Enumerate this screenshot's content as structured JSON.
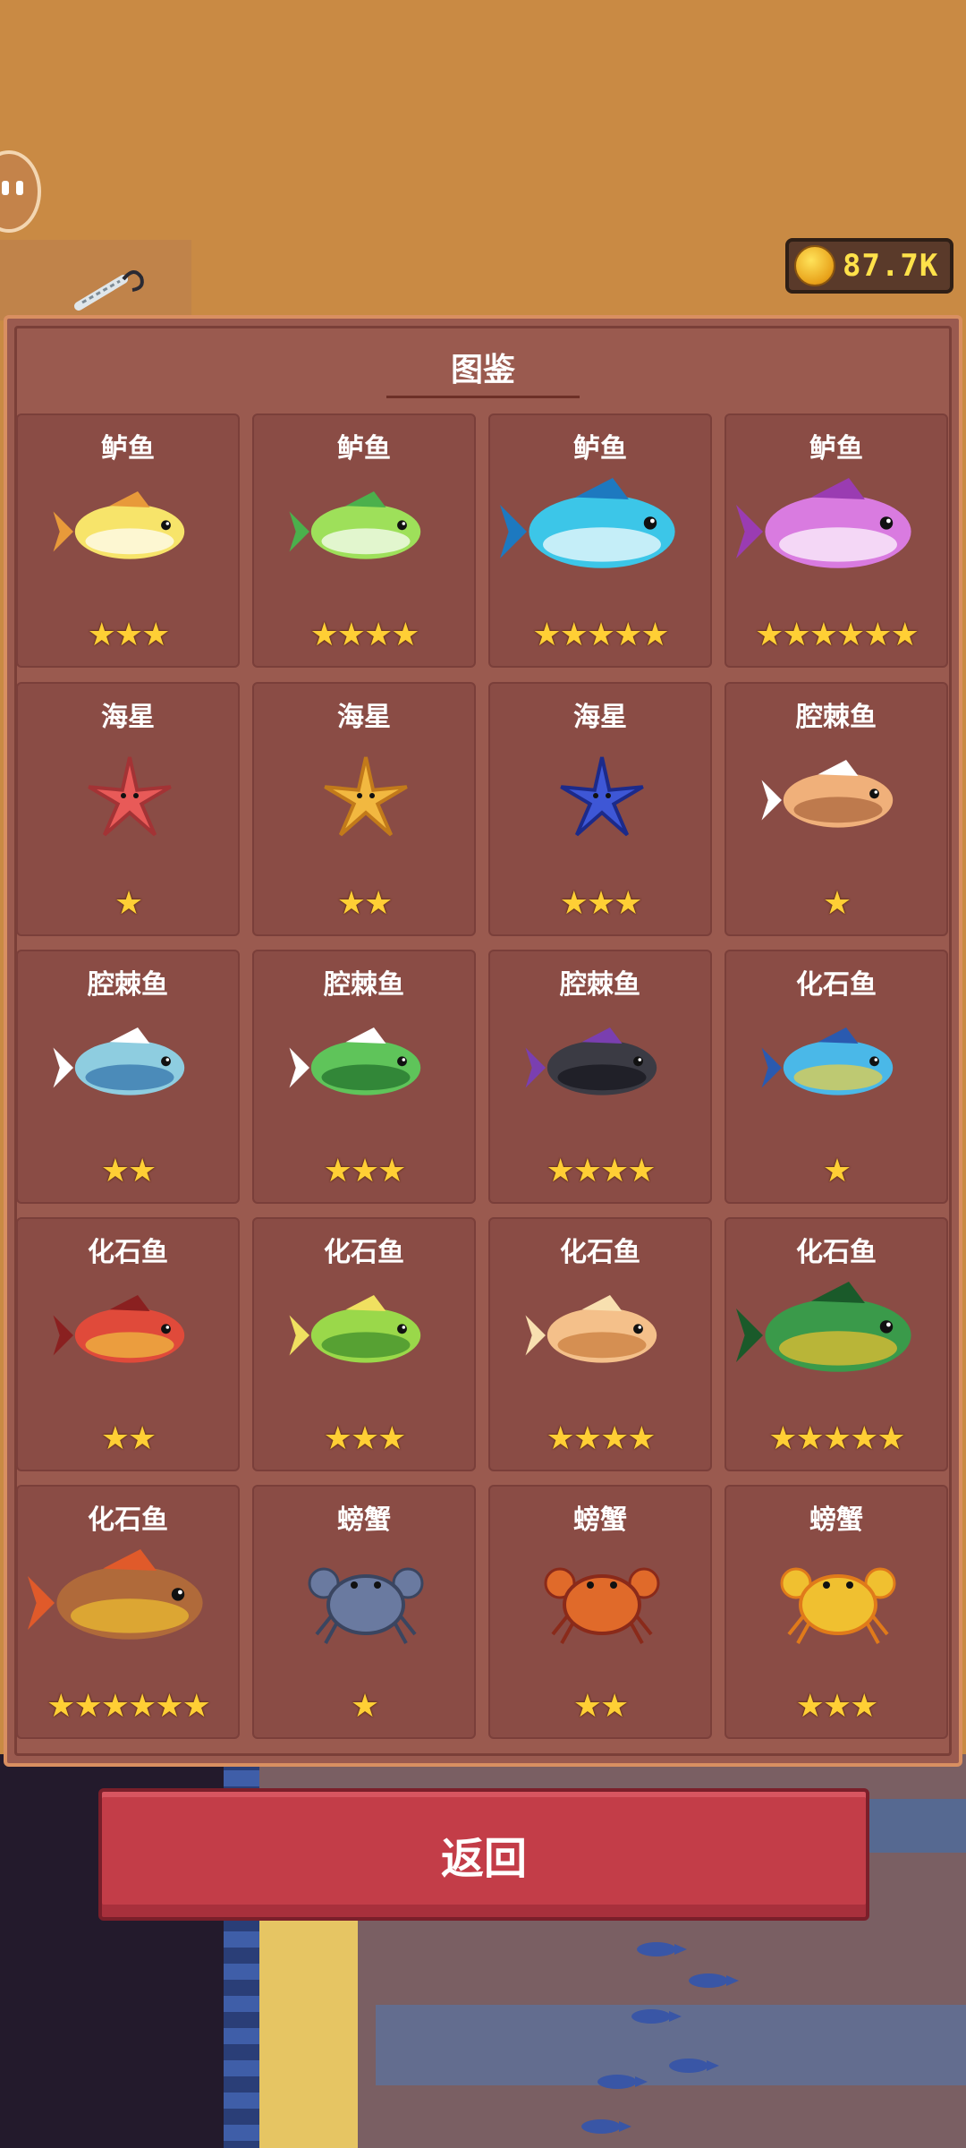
{
  "currency": {
    "coins": "87.7K",
    "icon": "gold-coin-icon"
  },
  "title": "图鉴",
  "cards": [
    {
      "name": "鲈鱼",
      "stars": 3,
      "icon": "fish-icon",
      "colors": [
        "#f7e46a",
        "#ffffff",
        "#e89a3a"
      ]
    },
    {
      "name": "鲈鱼",
      "stars": 4,
      "icon": "fish-icon",
      "colors": [
        "#9ee05a",
        "#ffffff",
        "#4bb04c"
      ]
    },
    {
      "name": "鲈鱼",
      "stars": 5,
      "icon": "fish-icon",
      "colors": [
        "#3cc6e8",
        "#ffffff",
        "#1d79c0"
      ]
    },
    {
      "name": "鲈鱼",
      "stars": 6,
      "icon": "fish-icon",
      "colors": [
        "#d97be0",
        "#ffffff",
        "#9a3cb2"
      ]
    },
    {
      "name": "海星",
      "stars": 1,
      "icon": "starfish-icon",
      "colors": [
        "#e85a58",
        "#a33335"
      ]
    },
    {
      "name": "海星",
      "stars": 2,
      "icon": "starfish-icon",
      "colors": [
        "#f2b840",
        "#c27a1a"
      ]
    },
    {
      "name": "海星",
      "stars": 3,
      "icon": "starfish-icon",
      "colors": [
        "#3e57d6",
        "#1c2a8a"
      ]
    },
    {
      "name": "腔棘鱼",
      "stars": 1,
      "icon": "fish-icon",
      "colors": [
        "#f0b07a",
        "#a8643a",
        "#ffffff"
      ]
    },
    {
      "name": "腔棘鱼",
      "stars": 2,
      "icon": "fish-icon",
      "colors": [
        "#8ecde0",
        "#2f6fa8",
        "#ffffff"
      ]
    },
    {
      "name": "腔棘鱼",
      "stars": 3,
      "icon": "fish-icon",
      "colors": [
        "#5fc45a",
        "#1f6e2a",
        "#ffffff"
      ]
    },
    {
      "name": "腔棘鱼",
      "stars": 4,
      "icon": "fish-icon",
      "colors": [
        "#3b3b44",
        "#15151c",
        "#7a3fb0"
      ]
    },
    {
      "name": "化石鱼",
      "stars": 1,
      "icon": "fish-icon",
      "colors": [
        "#4ab8e8",
        "#f0d040",
        "#2a5ab0"
      ]
    },
    {
      "name": "化石鱼",
      "stars": 2,
      "icon": "fish-icon",
      "colors": [
        "#e04a3a",
        "#f0c040",
        "#8a2020"
      ]
    },
    {
      "name": "化石鱼",
      "stars": 3,
      "icon": "fish-icon",
      "colors": [
        "#9ad84a",
        "#3a8a2a",
        "#f0e060"
      ]
    },
    {
      "name": "化石鱼",
      "stars": 4,
      "icon": "fish-icon",
      "colors": [
        "#f4c08a",
        "#c87a3a",
        "#f8e0b0"
      ]
    },
    {
      "name": "化石鱼",
      "stars": 5,
      "icon": "fish-icon",
      "colors": [
        "#3a9a4a",
        "#f0c030",
        "#1a5a2a"
      ]
    },
    {
      "name": "化石鱼",
      "stars": 6,
      "icon": "fish-icon",
      "colors": [
        "#b06a3a",
        "#f0c030",
        "#e05a2a"
      ]
    },
    {
      "name": "螃蟹",
      "stars": 1,
      "icon": "crab-icon",
      "colors": [
        "#6a7aa0",
        "#3a4560",
        "#c07a4a"
      ]
    },
    {
      "name": "螃蟹",
      "stars": 2,
      "icon": "crab-icon",
      "colors": [
        "#e06a2a",
        "#8a2a1a",
        "#f0c040"
      ]
    },
    {
      "name": "螃蟹",
      "stars": 3,
      "icon": "crab-icon",
      "colors": [
        "#f0c030",
        "#e07a1a",
        "#8a4a10"
      ]
    }
  ],
  "back_button": {
    "label": "返回"
  },
  "colors": {
    "panel": "#9a5a4f",
    "card": "#8a4c45",
    "star": "#ffcf35",
    "button": "#c33d48",
    "background": "#c98a44"
  }
}
